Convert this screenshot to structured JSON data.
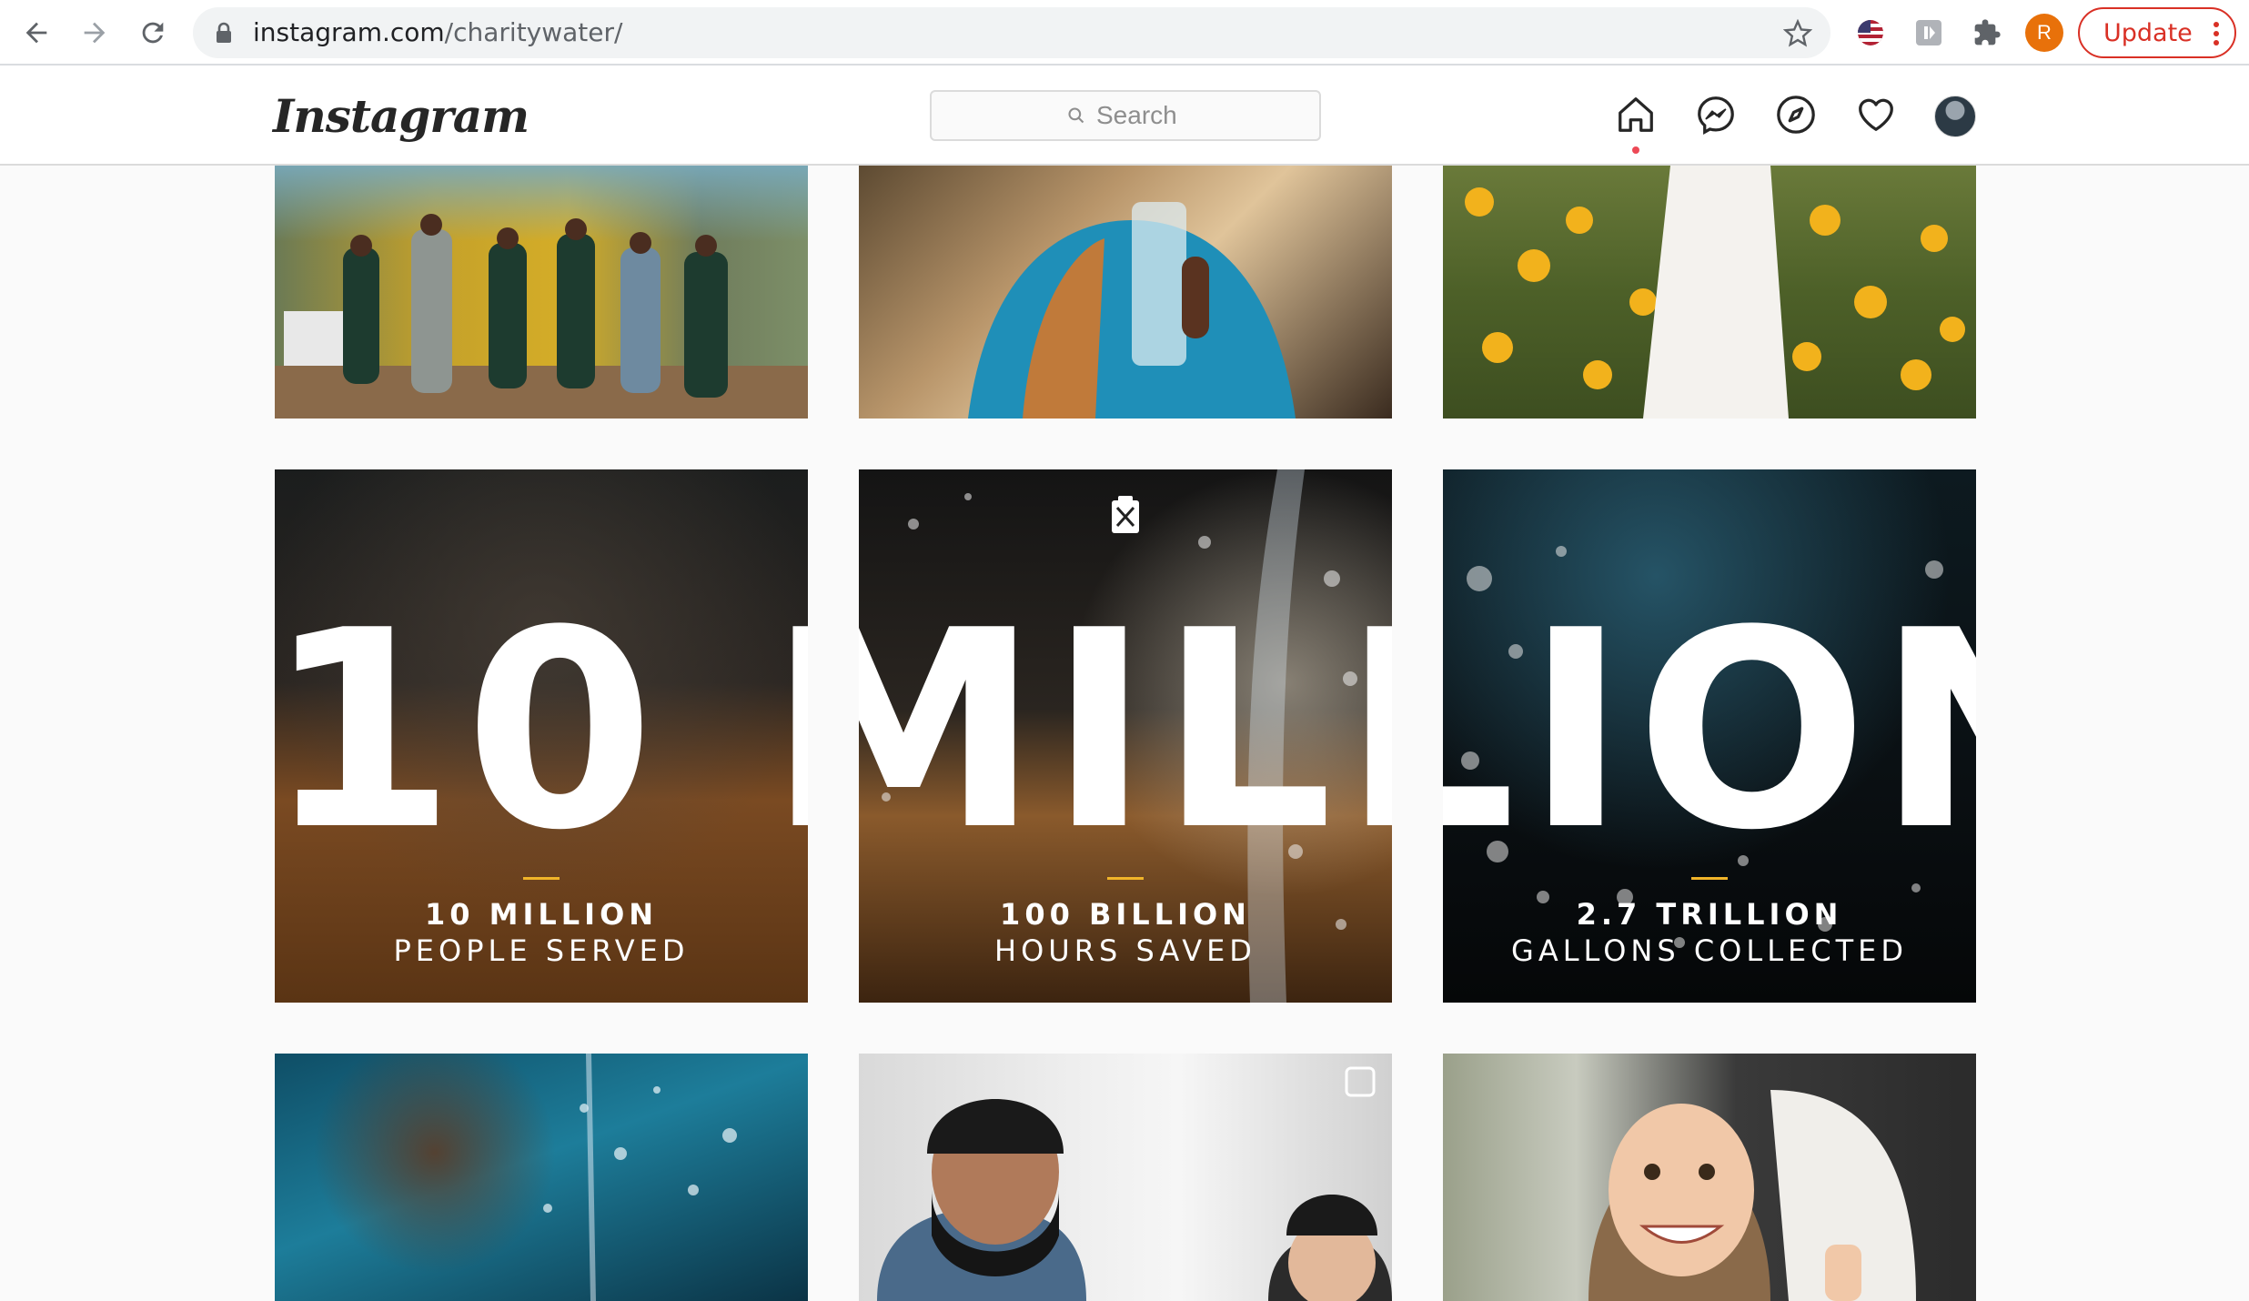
{
  "browser": {
    "url_host": "instagram.com",
    "url_path": "/charitywater/",
    "profile_initial": "R",
    "update_label": "Update",
    "accent": "#d93025"
  },
  "instagram": {
    "logo": "Instagram",
    "search_placeholder": "Search",
    "notification_dot_color": "#ed4956"
  },
  "grid": {
    "mega_headline": "10 MILLION",
    "tiles": [
      {
        "caption_big": "10 MILLION",
        "caption_small": "PEOPLE SERVED"
      },
      {
        "caption_big": "100 BILLION",
        "caption_small": "HOURS SAVED"
      },
      {
        "caption_big": "2.7 TRILLION",
        "caption_small": "GALLONS COLLECTED"
      }
    ]
  }
}
